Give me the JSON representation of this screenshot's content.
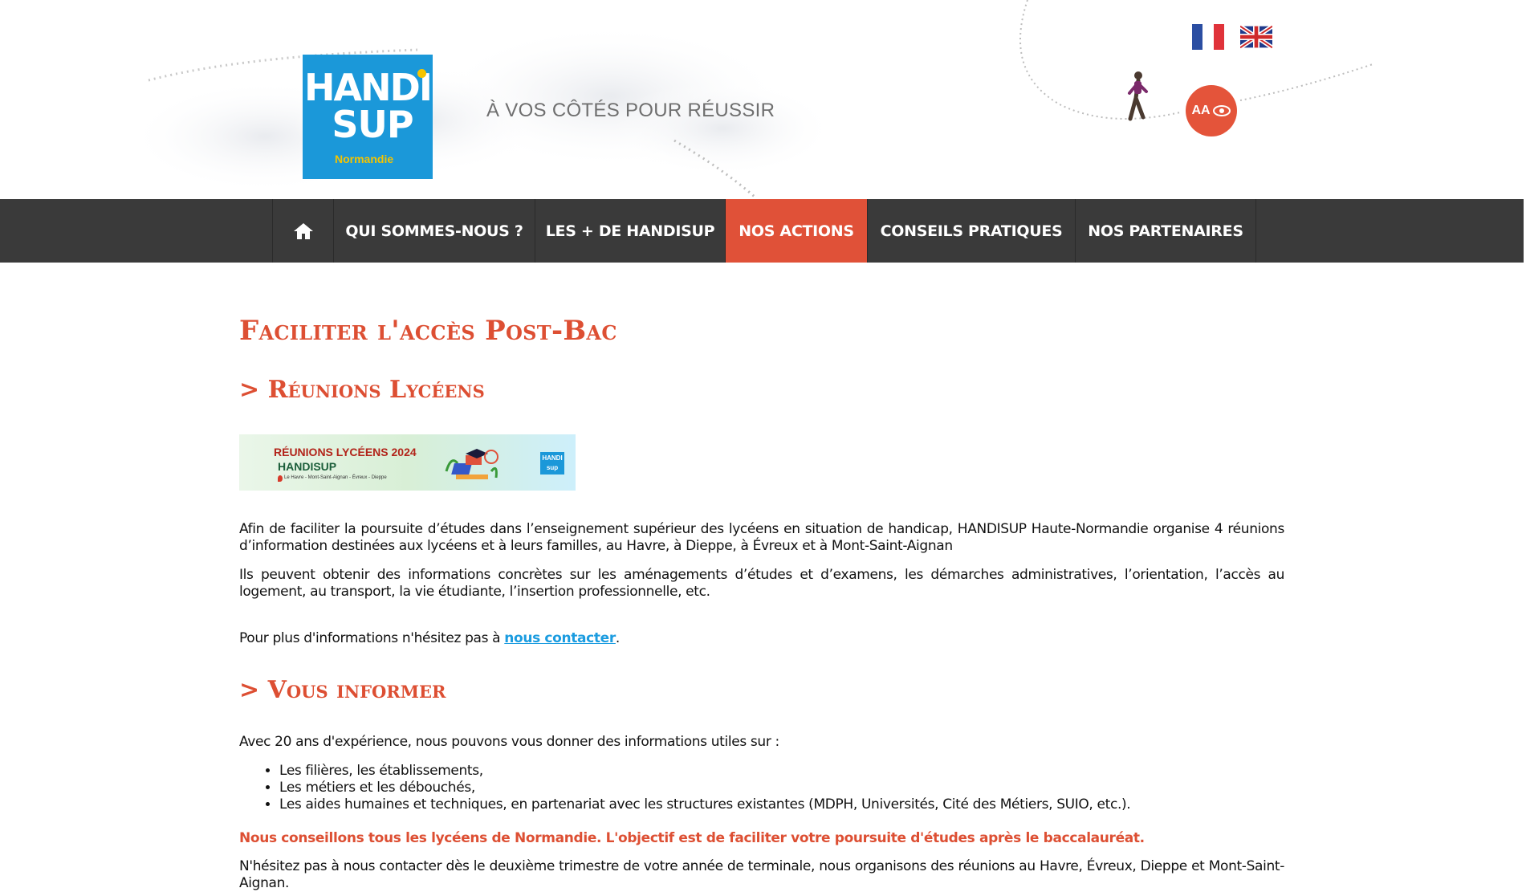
{
  "header": {
    "logo": {
      "line1": "HANDI",
      "line2": "SUP",
      "region": "Normandie"
    },
    "tagline": "À VOS CÔTÉS POUR RÉUSSIR",
    "languages": [
      {
        "label": "Français",
        "code": "fr"
      },
      {
        "label": "English",
        "code": "en"
      }
    ],
    "accessibility_label": "AA"
  },
  "nav": {
    "home": "Accueil",
    "items": [
      {
        "label": "QUI SOMMES-NOUS ?"
      },
      {
        "label": "LES + DE HANDISUP"
      },
      {
        "label": "NOS ACTIONS",
        "active": true
      },
      {
        "label": "CONSEILS PRATIQUES"
      },
      {
        "label": "NOS PARTENAIRES"
      }
    ]
  },
  "main": {
    "title": "Faciliter l'accès Post-Bac",
    "section1_title": "> Réunions Lycéens",
    "banner": {
      "line1": "RÉUNIONS LYCÉENS 2024",
      "line2": "HANDISUP",
      "line3": "Le Havre - Mont-Saint-Aignan - Évreux - Dieppe",
      "logo": "HANDI sup"
    },
    "para1": "Afin de faciliter la poursuite d’études dans l’enseignement supérieur des lycéens en situation de handicap, HANDISUP Haute-Normandie organise 4 réunions d’information destinées aux lycéens et à leurs familles, au Havre, à Dieppe, à Évreux et à Mont-Saint-Aignan",
    "para2": "Ils peuvent obtenir des informations concrètes sur les aménagements d’études et d’examens, les démarches administratives, l’orientation, l’accès au logement, au transport, la vie étudiante, l’insertion professionnelle, etc.",
    "contact_prefix": "Pour plus d'informations n'hésitez pas à ",
    "contact_link": "nous contacter",
    "contact_suffix": ".",
    "section2_title": "> Vous informer",
    "para4": "Avec 20 ans d'expérience, nous pouvons vous donner des informations utiles sur :",
    "list": [
      "Les filières, les établissements,",
      "Les métiers et les débouchés,",
      "Les aides humaines et techniques, en partenariat avec les structures existantes (MDPH, Universités, Cité des Métiers, SUIO, etc.)."
    ],
    "highlight": "Nous conseillons tous les lycéens de Normandie. L'objectif est de faciliter votre poursuite d'études après le baccalauréat.",
    "cut_line": "N'hésitez pas à nous contacter dès le deuxième trimestre de votre année de terminale, nous organisons des réunions au Havre, Évreux, Dieppe et Mont-Saint-Aignan."
  },
  "colors": {
    "accent": "#dd4f33",
    "nav_bg": "#3a3a3a",
    "logo_blue": "#1b98d9",
    "link": "#1b9ce0"
  }
}
